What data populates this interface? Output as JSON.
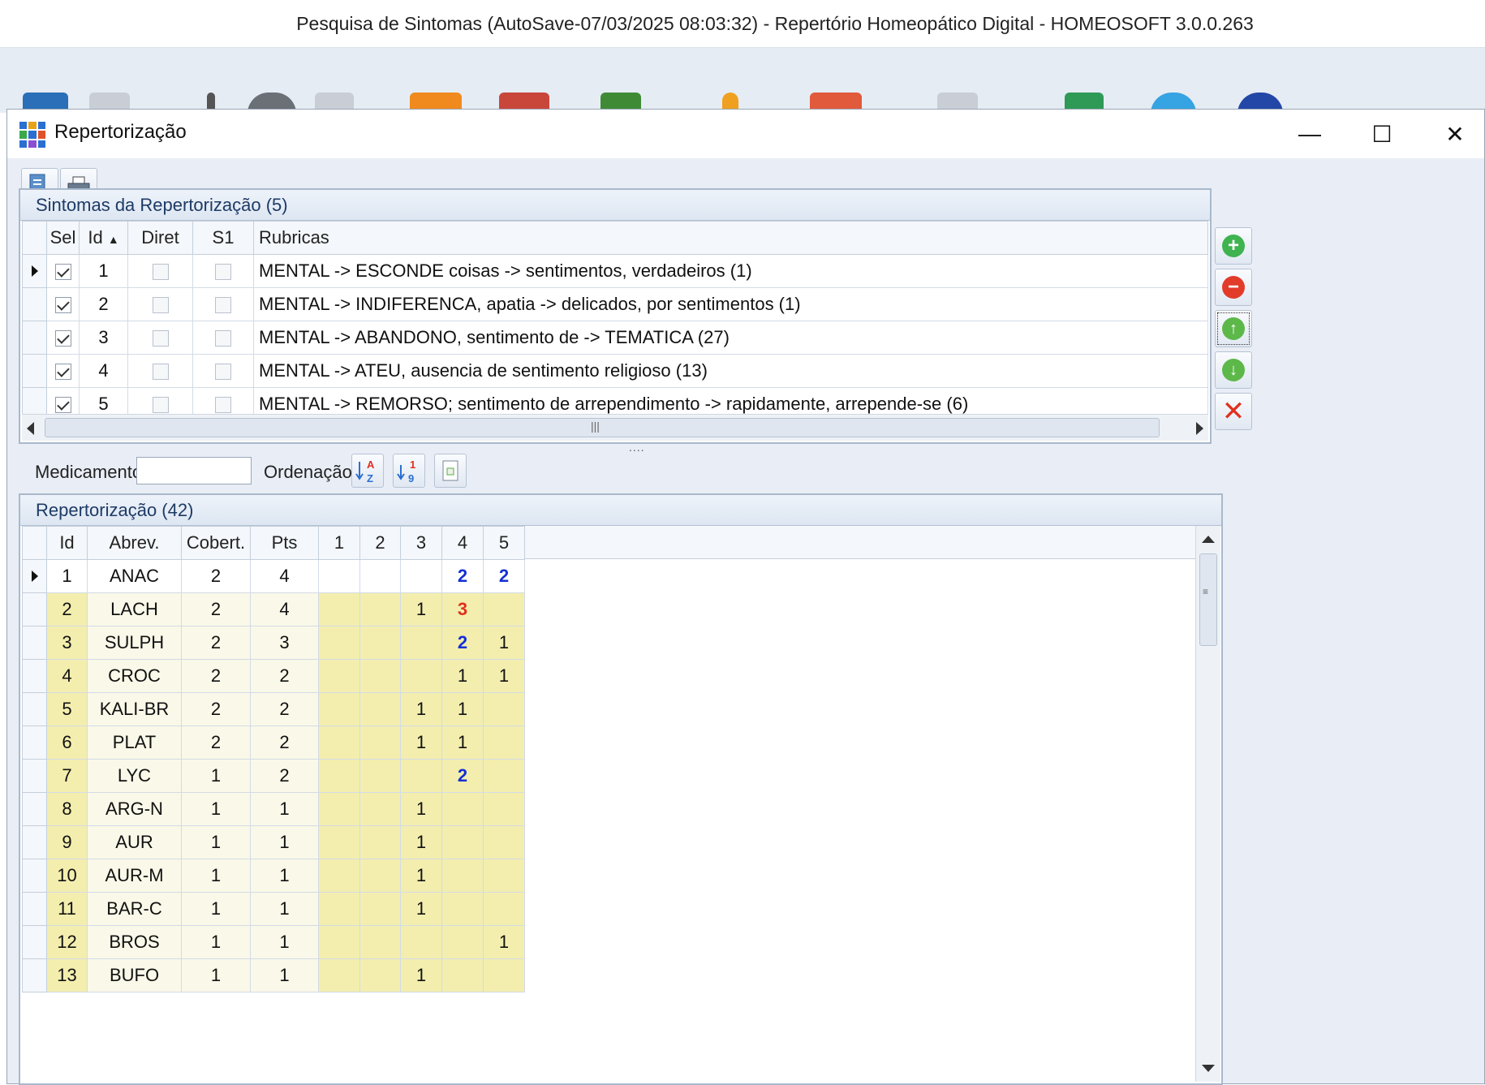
{
  "app": {
    "title": "Pesquisa de Sintomas (AutoSave-07/03/2025 08:03:32) - Repertório Homeopático Digital - HOMEOSOFT 3.0.0.263"
  },
  "window": {
    "title": "Repertorização",
    "minimize": "—",
    "maximize": "☐",
    "close": "✕"
  },
  "symptoms_panel": {
    "title": "Sintomas da Repertorização (5)",
    "columns": {
      "sel": "Sel",
      "id": "Id",
      "diret": "Diret",
      "s1": "S1",
      "rubricas": "Rubricas"
    },
    "rows": [
      {
        "id": "1",
        "sel": true,
        "diret": false,
        "s1": false,
        "rubrica": "MENTAL -> ESCONDE coisas -> sentimentos, verdadeiros (1)"
      },
      {
        "id": "2",
        "sel": true,
        "diret": false,
        "s1": false,
        "rubrica": "MENTAL -> INDIFERENCA, apatia -> delicados, por sentimentos (1)"
      },
      {
        "id": "3",
        "sel": true,
        "diret": false,
        "s1": false,
        "rubrica": "MENTAL -> ABANDONO, sentimento de -> TEMATICA (27)"
      },
      {
        "id": "4",
        "sel": true,
        "diret": false,
        "s1": false,
        "rubrica": "MENTAL -> ATEU, ausencia de sentimento religioso (13)"
      },
      {
        "id": "5",
        "sel": true,
        "diret": false,
        "s1": false,
        "rubrica": "MENTAL -> REMORSO; sentimento de arrependimento -> rapidamente, arrepende-se (6)"
      }
    ]
  },
  "filter": {
    "medicamento_label": "Medicamento:",
    "medicamento_value": "",
    "ordenacao_label": "Ordenação:"
  },
  "repertorization_panel": {
    "title": "Repertorização (42)",
    "columns": {
      "id": "Id",
      "abrev": "Abrev.",
      "cobert": "Cobert.",
      "pts": "Pts",
      "c1": "1",
      "c2": "2",
      "c3": "3",
      "c4": "4",
      "c5": "5"
    },
    "rows": [
      {
        "id": "1",
        "abrev": "ANAC",
        "cobert": "2",
        "pts": "4",
        "c1": "",
        "c2": "",
        "c3": "",
        "c4": "2",
        "c5": "2"
      },
      {
        "id": "2",
        "abrev": "LACH",
        "cobert": "2",
        "pts": "4",
        "c1": "",
        "c2": "",
        "c3": "1",
        "c4": "3",
        "c5": ""
      },
      {
        "id": "3",
        "abrev": "SULPH",
        "cobert": "2",
        "pts": "3",
        "c1": "",
        "c2": "",
        "c3": "",
        "c4": "2",
        "c5": "1"
      },
      {
        "id": "4",
        "abrev": "CROC",
        "cobert": "2",
        "pts": "2",
        "c1": "",
        "c2": "",
        "c3": "",
        "c4": "1",
        "c5": "1"
      },
      {
        "id": "5",
        "abrev": "KALI-BR",
        "cobert": "2",
        "pts": "2",
        "c1": "",
        "c2": "",
        "c3": "1",
        "c4": "1",
        "c5": ""
      },
      {
        "id": "6",
        "abrev": "PLAT",
        "cobert": "2",
        "pts": "2",
        "c1": "",
        "c2": "",
        "c3": "1",
        "c4": "1",
        "c5": ""
      },
      {
        "id": "7",
        "abrev": "LYC",
        "cobert": "1",
        "pts": "2",
        "c1": "",
        "c2": "",
        "c3": "",
        "c4": "2",
        "c5": ""
      },
      {
        "id": "8",
        "abrev": "ARG-N",
        "cobert": "1",
        "pts": "1",
        "c1": "",
        "c2": "",
        "c3": "1",
        "c4": "",
        "c5": ""
      },
      {
        "id": "9",
        "abrev": "AUR",
        "cobert": "1",
        "pts": "1",
        "c1": "",
        "c2": "",
        "c3": "1",
        "c4": "",
        "c5": ""
      },
      {
        "id": "10",
        "abrev": "AUR-M",
        "cobert": "1",
        "pts": "1",
        "c1": "",
        "c2": "",
        "c3": "1",
        "c4": "",
        "c5": ""
      },
      {
        "id": "11",
        "abrev": "BAR-C",
        "cobert": "1",
        "pts": "1",
        "c1": "",
        "c2": "",
        "c3": "1",
        "c4": "",
        "c5": ""
      },
      {
        "id": "12",
        "abrev": "BROS",
        "cobert": "1",
        "pts": "1",
        "c1": "",
        "c2": "",
        "c3": "",
        "c4": "",
        "c5": "1"
      },
      {
        "id": "13",
        "abrev": "BUFO",
        "cobert": "1",
        "pts": "1",
        "c1": "",
        "c2": "",
        "c3": "1",
        "c4": "",
        "c5": ""
      }
    ]
  },
  "colors": {
    "grade2": "#1530d6",
    "grade3": "#e0301e",
    "highlight": "#f3eeae"
  }
}
